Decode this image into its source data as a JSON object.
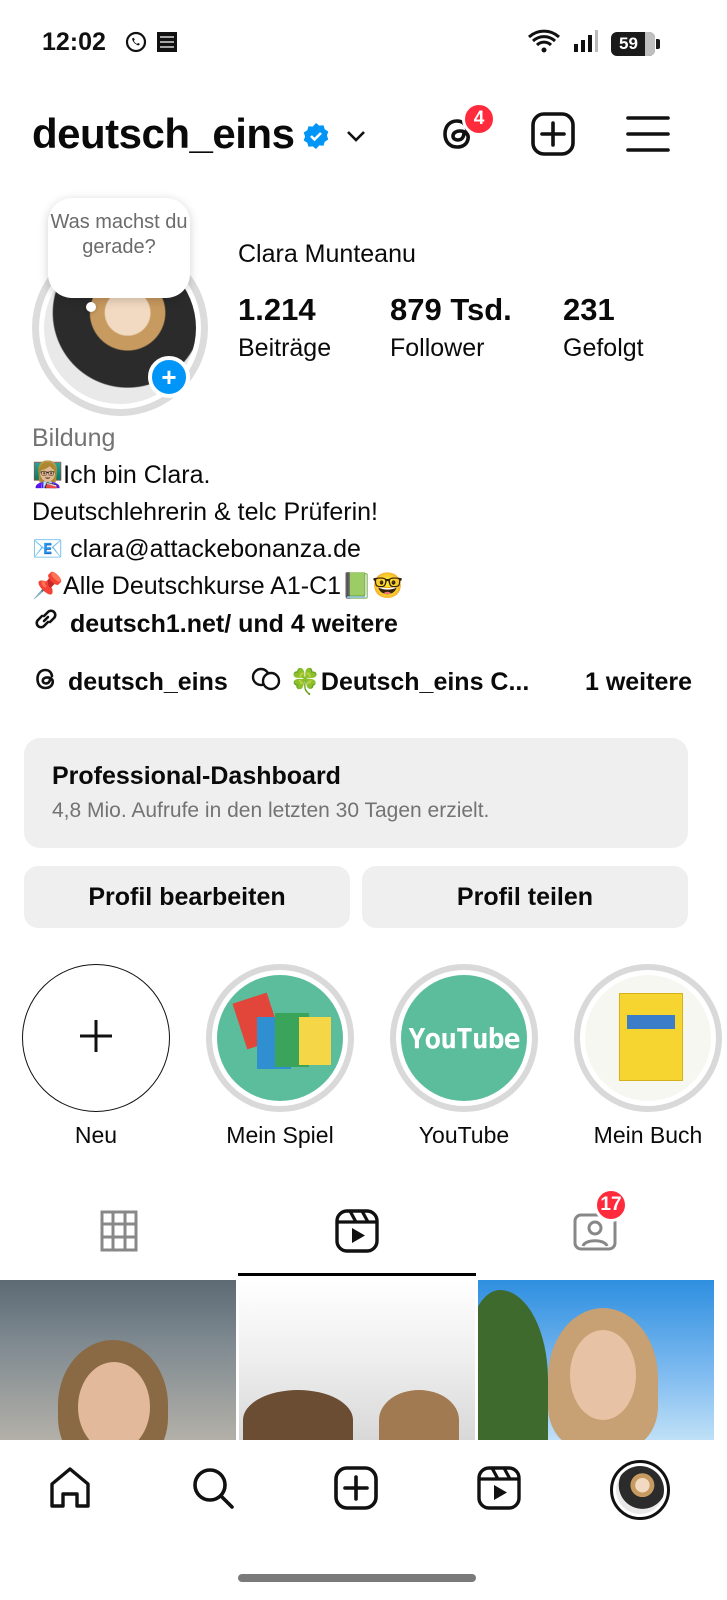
{
  "status_bar": {
    "time": "12:02",
    "battery": "59",
    "icons": [
      "whatsapp-icon",
      "app-icon",
      "wifi-icon",
      "signal-icon",
      "battery-icon"
    ]
  },
  "header": {
    "username": "deutsch_eins",
    "threads_badge": "4",
    "icons": [
      "verified-icon",
      "chevron-down-icon",
      "threads-icon",
      "create-icon",
      "menu-icon"
    ]
  },
  "profile": {
    "note": "Was machst du gerade?",
    "full_name": "Clara Munteanu",
    "stats": [
      {
        "value": "1.214",
        "label": "Beiträge"
      },
      {
        "value": "879 Tsd.",
        "label": "Follower"
      },
      {
        "value": "231",
        "label": "Gefolgt"
      }
    ],
    "category": "Bildung",
    "bio_lines": [
      "Ich bin Clara.",
      "Deutschlehrerin & telc Prüferin!",
      "📧 clara@attackebonanza.de",
      "📌Alle Deutschkurse A1-C1📗🤓"
    ],
    "teacher_emoji": "👩🏼‍🏫",
    "link": "deutsch1.net/ und 4 weitere"
  },
  "links_row": {
    "threads": "deutsch_eins",
    "channel": "🍀Deutsch_eins C...",
    "more": "1 weitere"
  },
  "dashboard": {
    "title": "Professional-Dashboard",
    "subtitle": "4,8 Mio. Aufrufe in den letzten 30 Tagen erzielt."
  },
  "buttons": {
    "edit": "Profil bearbeiten",
    "share": "Profil teilen"
  },
  "highlights": [
    {
      "label": "Neu"
    },
    {
      "label": "Mein Spiel"
    },
    {
      "label": "YouTube"
    },
    {
      "label": "Mein Buch"
    }
  ],
  "highlight_youtube_text": "YouTube",
  "tabs": {
    "tagged_badge": "17"
  },
  "colors": {
    "accent": "#0095f6",
    "badge": "#ff2b3d",
    "highlight_green": "#5bbd9c"
  }
}
